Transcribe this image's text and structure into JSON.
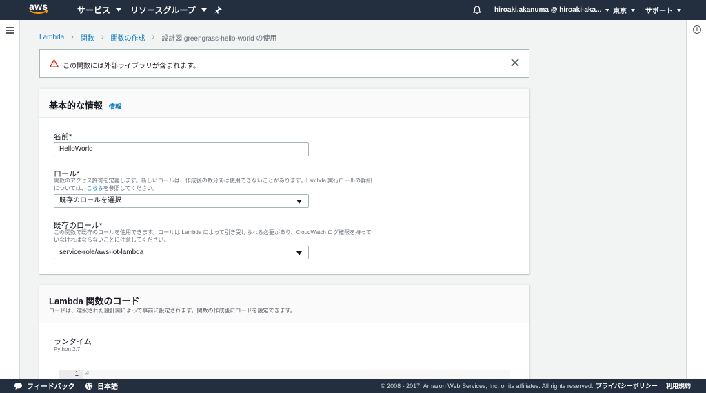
{
  "topnav": {
    "logo_text": "aws",
    "services_label": "サービス",
    "resource_groups_label": "リソースグループ",
    "pin_icon": "pin-icon",
    "bell_icon": "bell-icon",
    "account_label": "hiroaki.akanuma @ hiroaki-aka...",
    "region_label": "東京",
    "support_label": "サポート"
  },
  "breadcrumb": {
    "items": [
      "Lambda",
      "関数",
      "関数の作成"
    ],
    "current": "設計図 greengrass-hello-world の使用"
  },
  "alert": {
    "icon": "warning-icon",
    "text": "この関数には外部ライブラリが含まれます。"
  },
  "basic_info": {
    "title": "基本的な情報",
    "info_link": "情報",
    "name_label": "名前*",
    "name_value": "HelloWorld",
    "role_label": "ロール*",
    "role_desc_1": "関数のアクセス許可を定義します。新しいロールは、作成後の数分間は使用できないことがあります。Lambda 実行ロールの詳細",
    "role_desc_2_pre": "については、",
    "role_desc_2_link": "こちら",
    "role_desc_2_post": "を参照してください。",
    "role_select_value": "既存のロールを選択",
    "existing_role_label": "既存のロール*",
    "existing_role_desc_1": "この関数で既存のロールを使用できます。ロールは Lambda によって引き受けられる必要があり、CloudWatch ログ権限を持って",
    "existing_role_desc_2": "いなければならないことに注意してください。",
    "existing_role_value": "service-role/aws-iot-lambda"
  },
  "code_panel": {
    "title": "Lambda 関数のコード",
    "subtitle": "コードは、選択された設計図によって事前に設定されます。関数の作成後にコードを設定できます。",
    "runtime_label": "ランタイム",
    "runtime_value": "Python 2.7",
    "line_number": "1",
    "code_line": "#"
  },
  "footer": {
    "feedback_label": "フィードバック",
    "language_label": "日本語",
    "copyright": "© 2008 - 2017, Amazon Web Services, Inc. or its affiliates. All rights reserved.",
    "privacy_label": "プライバシーポリシー",
    "terms_label": "利用規約"
  },
  "colors": {
    "nav_bg": "#232f3e",
    "link": "#0073bb",
    "warning": "#d13212",
    "page_bg": "#f2f3f3"
  }
}
